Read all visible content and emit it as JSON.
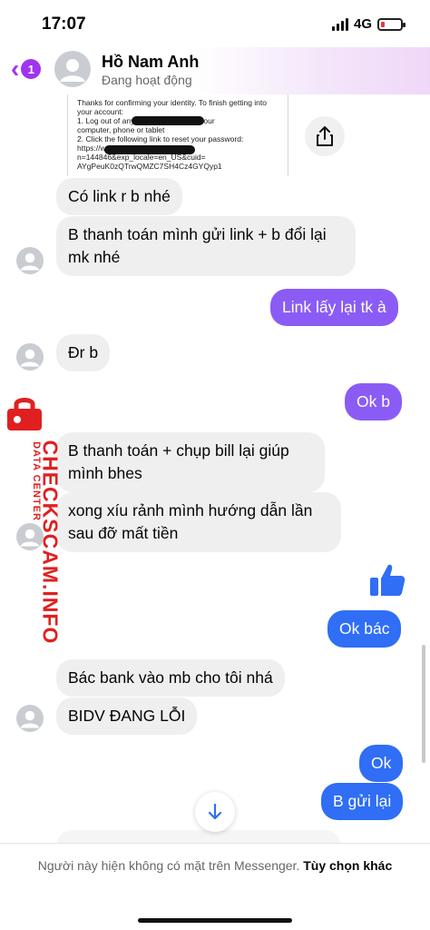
{
  "status_bar": {
    "time": "17:07",
    "network": "4G",
    "battery_level": 0.18
  },
  "header": {
    "back_badge": "1",
    "contact_name": "Hồ Nam Anh",
    "contact_status": "Đang hoạt động"
  },
  "shared_email": {
    "lines": [
      "Thanks for confirming your identity. To finish getting into",
      "your account:",
      "1. Log out of any           accounts open on your",
      "computer, phone or tablet",
      "2. Click the following link to reset your password:",
      "https://w                    om/recover/code/?",
      "n=144846&exp_locale=en_US&cuid=",
      "AYgPeuK0zQTrwQMZC7SH4Cz4GYQyp1"
    ]
  },
  "messages": [
    {
      "id": "m1",
      "side": "in",
      "text": "Có link r b nhé"
    },
    {
      "id": "m2",
      "side": "in",
      "text": "B thanh toán mình gửi link + b đổi lại mk nhé"
    },
    {
      "id": "m3",
      "side": "out",
      "text": "Link lấy lại tk à"
    },
    {
      "id": "m4",
      "side": "in",
      "text": "Đr b"
    },
    {
      "id": "m5",
      "side": "out",
      "text": "Ok b"
    },
    {
      "id": "m6",
      "side": "in",
      "text": "B thanh toán + chụp bill lại giúp mình bhes"
    },
    {
      "id": "m7",
      "side": "in",
      "text": "xong xíu rảnh mình hướng dẫn lần sau đỡ mất tiền"
    },
    {
      "id": "m8",
      "side": "out",
      "text": "Ok bác"
    },
    {
      "id": "m9",
      "side": "in",
      "text": "Bác bank vào mb cho tôi nhá"
    },
    {
      "id": "m10",
      "side": "in",
      "text": "BIDV ĐANG LỖI"
    },
    {
      "id": "m11",
      "side": "out",
      "text": "Ok"
    },
    {
      "id": "m12",
      "side": "out",
      "text": "B gửi lại"
    }
  ],
  "watermark": {
    "brand": "CHECKSCAM.INFO",
    "sub": "DATA CENTER"
  },
  "footer": {
    "notice": "Người này hiện không có mặt trên Messenger.",
    "link": "Tùy chọn khác"
  },
  "colors": {
    "accent": "#a034f0",
    "outgoing_purple": "#8a5cf5",
    "outgoing_blue": "#2f6ef5",
    "incoming": "#efefef",
    "watermark": "#e02020"
  }
}
